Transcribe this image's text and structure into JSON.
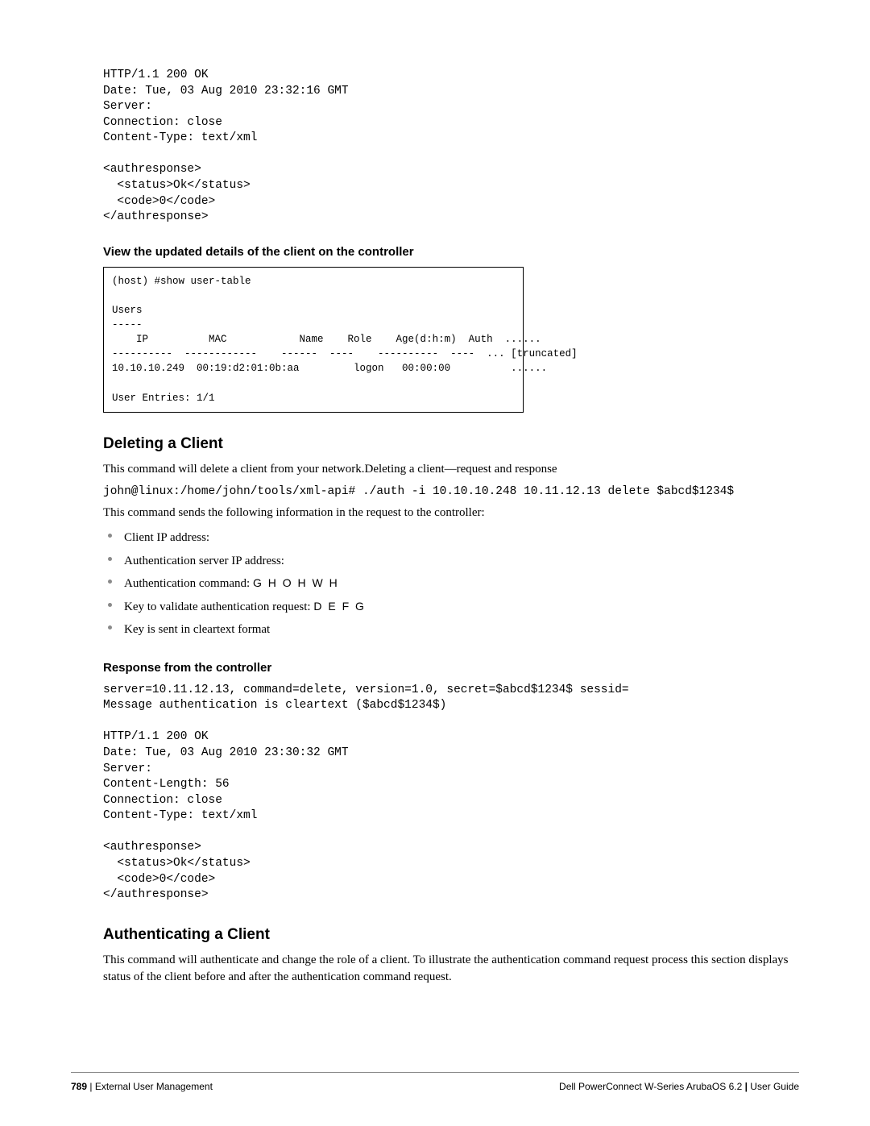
{
  "response1": "HTTP/1.1 200 OK\nDate: Tue, 03 Aug 2010 23:32:16 GMT\nServer:\nConnection: close\nContent-Type: text/xml\n\n<authresponse>\n  <status>Ok</status>\n  <code>0</code>\n</authresponse>",
  "heading_view": "View the updated details of the client on the controller",
  "user_table": "(host) #show user-table\n\nUsers\n-----\n    IP          MAC            Name    Role    Age(d:h:m)  Auth  ......\n----------  ------------    ------  ----    ----------  ----  ... [truncated]\n10.10.10.249  00:19:d2:01:0b:aa         logon   00:00:00          ......\n\nUser Entries: 1/1",
  "section_delete": "Deleting a Client",
  "delete_p1": "This command will delete a client from your network.Deleting a client—request and response",
  "delete_cmd": "john@linux:/home/john/tools/xml-api# ./auth -i 10.10.10.248 10.11.12.13 delete $abcd$1234$",
  "delete_p2": "This command sends the following information in the request to the controller:",
  "bullets": [
    {
      "text": "Client IP address:"
    },
    {
      "text": "Authentication server IP address:"
    },
    {
      "text": "Authentication command: ",
      "code": "G H O H W H"
    },
    {
      "text": "Key to validate authentication request: ",
      "code": "  D E F G"
    },
    {
      "text": "Key is sent in cleartext format"
    }
  ],
  "heading_response": "Response from the controller",
  "response2": "server=10.11.12.13, command=delete, version=1.0, secret=$abcd$1234$ sessid=\nMessage authentication is cleartext ($abcd$1234$)\n\nHTTP/1.1 200 OK\nDate: Tue, 03 Aug 2010 23:30:32 GMT\nServer:\nContent-Length: 56\nConnection: close\nContent-Type: text/xml\n\n<authresponse>\n  <status>Ok</status>\n  <code>0</code>\n</authresponse>",
  "section_auth": "Authenticating a Client",
  "auth_p1": "This command will authenticate and change the role of a client. To illustrate the authentication command request process this section displays status of the client before and after the authentication command request.",
  "footer": {
    "page_no": "789",
    "left_sep": " | ",
    "left_text": "External User Management",
    "right_product": "Dell PowerConnect W-Series ArubaOS 6.2",
    "right_sep": "  |  ",
    "right_text": "User Guide"
  }
}
